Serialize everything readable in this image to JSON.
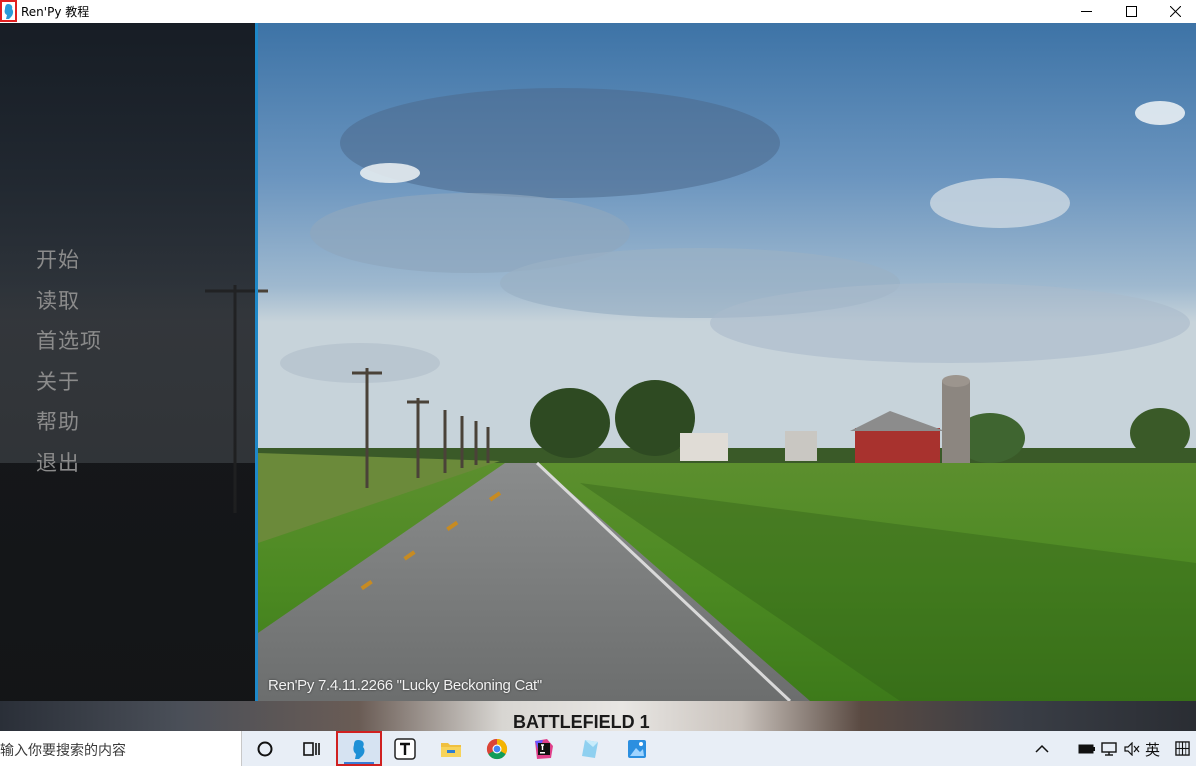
{
  "window": {
    "title": "Ren'Py 教程"
  },
  "menu": {
    "items": [
      {
        "label": "开始"
      },
      {
        "label": "读取"
      },
      {
        "label": "首选项"
      },
      {
        "label": "关于"
      },
      {
        "label": "帮助"
      },
      {
        "label": "退出"
      }
    ],
    "text_color": "#8b8b8b",
    "accent_color": "#1e88c8"
  },
  "game": {
    "version": "Ren'Py 7.4.11.2266 \"Lucky Beckoning Cat\""
  },
  "wallpaper": {
    "text": "BATTLEFIELD 1"
  },
  "taskbar": {
    "search_placeholder": "输入你要搜索的内容",
    "apps": [
      {
        "icon": "cortana-circle-icon"
      },
      {
        "icon": "task-view-icon"
      },
      {
        "icon": "renpy-icon",
        "active": true
      },
      {
        "icon": "typora-icon"
      },
      {
        "icon": "file-explorer-icon"
      },
      {
        "icon": "chrome-icon"
      },
      {
        "icon": "jetbrains-icon"
      },
      {
        "icon": "app-icon"
      },
      {
        "icon": "photos-icon"
      }
    ],
    "tray": {
      "ime": "英"
    }
  }
}
